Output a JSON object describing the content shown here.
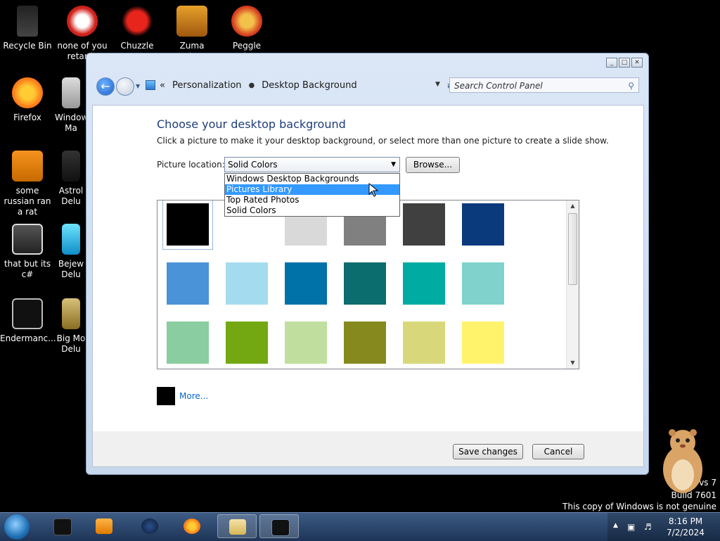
{
  "desktop": {
    "icons": [
      {
        "label": "Recycle Bin"
      },
      {
        "label": "none of you retards"
      },
      {
        "label": "Chuzzle"
      },
      {
        "label": "Zuma Deluxe"
      },
      {
        "label": "Peggle Deluxe"
      },
      {
        "label": "Firefox"
      },
      {
        "label": "Window Ma"
      },
      {
        "label": "some russian ran a rat"
      },
      {
        "label": "Astrol Delu"
      },
      {
        "label": "that but its c#"
      },
      {
        "label": "Bejew Delu"
      },
      {
        "label": "Endermanc..."
      },
      {
        "label": "Big Mo Delu"
      }
    ],
    "watermark": {
      "line1": "vs 7",
      "line2": "Build 7601",
      "line3": "This copy of Windows is not genuine"
    }
  },
  "window": {
    "caption_buttons": {
      "minimize": "_",
      "maximize": "□",
      "close": "✕"
    },
    "address": {
      "chevron": "«",
      "crumb1": "Personalization",
      "crumb2": "Desktop Background",
      "search_placeholder": "Search Control Panel"
    },
    "heading": "Choose your desktop background",
    "description": "Click a picture to make it your desktop background, or select more than one picture to create a slide show.",
    "picture_location_label": "Picture location:",
    "picture_location_value": "Solid Colors",
    "browse_label": "Browse...",
    "dropdown_options": [
      "Windows Desktop Backgrounds",
      "Pictures Library",
      "Top Rated Photos",
      "Solid Colors"
    ],
    "selected_option_index": 1,
    "swatches": [
      "#000000",
      "#ffffff",
      "#d9d9d9",
      "#808080",
      "#404040",
      "#0b3a7c",
      "#4a93d8",
      "#a5dbee",
      "#0072a8",
      "#0b6d6d",
      "#00aca2",
      "#7fd3cc",
      "#8acda0",
      "#73a812",
      "#c0df9e",
      "#868a1e",
      "#d8d87a",
      "#fff36c"
    ],
    "selected_swatch_index": 0,
    "more_label": "More...",
    "save_label": "Save changes",
    "cancel_label": "Cancel"
  },
  "taskbar": {
    "time": "8:16 PM",
    "date": "7/2/2024"
  },
  "colors": {
    "accent": "#3399ff",
    "heading": "#1e3c7a",
    "link": "#0066cc"
  }
}
